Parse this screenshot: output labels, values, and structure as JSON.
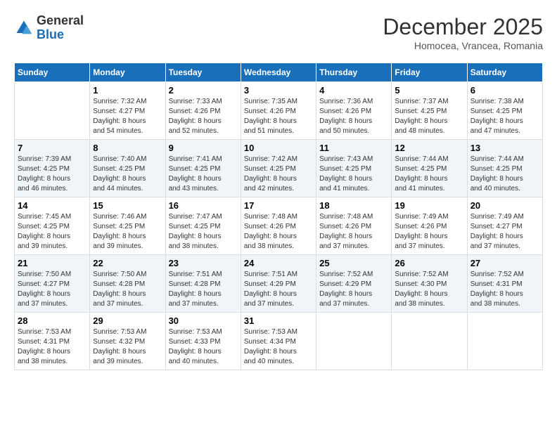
{
  "header": {
    "logo_line1": "General",
    "logo_line2": "Blue",
    "month_title": "December 2025",
    "subtitle": "Homocea, Vrancea, Romania"
  },
  "weekdays": [
    "Sunday",
    "Monday",
    "Tuesday",
    "Wednesday",
    "Thursday",
    "Friday",
    "Saturday"
  ],
  "weeks": [
    [
      {
        "day": "",
        "info": ""
      },
      {
        "day": "1",
        "info": "Sunrise: 7:32 AM\nSunset: 4:27 PM\nDaylight: 8 hours\nand 54 minutes."
      },
      {
        "day": "2",
        "info": "Sunrise: 7:33 AM\nSunset: 4:26 PM\nDaylight: 8 hours\nand 52 minutes."
      },
      {
        "day": "3",
        "info": "Sunrise: 7:35 AM\nSunset: 4:26 PM\nDaylight: 8 hours\nand 51 minutes."
      },
      {
        "day": "4",
        "info": "Sunrise: 7:36 AM\nSunset: 4:26 PM\nDaylight: 8 hours\nand 50 minutes."
      },
      {
        "day": "5",
        "info": "Sunrise: 7:37 AM\nSunset: 4:25 PM\nDaylight: 8 hours\nand 48 minutes."
      },
      {
        "day": "6",
        "info": "Sunrise: 7:38 AM\nSunset: 4:25 PM\nDaylight: 8 hours\nand 47 minutes."
      }
    ],
    [
      {
        "day": "7",
        "info": "Sunrise: 7:39 AM\nSunset: 4:25 PM\nDaylight: 8 hours\nand 46 minutes."
      },
      {
        "day": "8",
        "info": "Sunrise: 7:40 AM\nSunset: 4:25 PM\nDaylight: 8 hours\nand 44 minutes."
      },
      {
        "day": "9",
        "info": "Sunrise: 7:41 AM\nSunset: 4:25 PM\nDaylight: 8 hours\nand 43 minutes."
      },
      {
        "day": "10",
        "info": "Sunrise: 7:42 AM\nSunset: 4:25 PM\nDaylight: 8 hours\nand 42 minutes."
      },
      {
        "day": "11",
        "info": "Sunrise: 7:43 AM\nSunset: 4:25 PM\nDaylight: 8 hours\nand 41 minutes."
      },
      {
        "day": "12",
        "info": "Sunrise: 7:44 AM\nSunset: 4:25 PM\nDaylight: 8 hours\nand 41 minutes."
      },
      {
        "day": "13",
        "info": "Sunrise: 7:44 AM\nSunset: 4:25 PM\nDaylight: 8 hours\nand 40 minutes."
      }
    ],
    [
      {
        "day": "14",
        "info": "Sunrise: 7:45 AM\nSunset: 4:25 PM\nDaylight: 8 hours\nand 39 minutes."
      },
      {
        "day": "15",
        "info": "Sunrise: 7:46 AM\nSunset: 4:25 PM\nDaylight: 8 hours\nand 39 minutes."
      },
      {
        "day": "16",
        "info": "Sunrise: 7:47 AM\nSunset: 4:25 PM\nDaylight: 8 hours\nand 38 minutes."
      },
      {
        "day": "17",
        "info": "Sunrise: 7:48 AM\nSunset: 4:26 PM\nDaylight: 8 hours\nand 38 minutes."
      },
      {
        "day": "18",
        "info": "Sunrise: 7:48 AM\nSunset: 4:26 PM\nDaylight: 8 hours\nand 37 minutes."
      },
      {
        "day": "19",
        "info": "Sunrise: 7:49 AM\nSunset: 4:26 PM\nDaylight: 8 hours\nand 37 minutes."
      },
      {
        "day": "20",
        "info": "Sunrise: 7:49 AM\nSunset: 4:27 PM\nDaylight: 8 hours\nand 37 minutes."
      }
    ],
    [
      {
        "day": "21",
        "info": "Sunrise: 7:50 AM\nSunset: 4:27 PM\nDaylight: 8 hours\nand 37 minutes."
      },
      {
        "day": "22",
        "info": "Sunrise: 7:50 AM\nSunset: 4:28 PM\nDaylight: 8 hours\nand 37 minutes."
      },
      {
        "day": "23",
        "info": "Sunrise: 7:51 AM\nSunset: 4:28 PM\nDaylight: 8 hours\nand 37 minutes."
      },
      {
        "day": "24",
        "info": "Sunrise: 7:51 AM\nSunset: 4:29 PM\nDaylight: 8 hours\nand 37 minutes."
      },
      {
        "day": "25",
        "info": "Sunrise: 7:52 AM\nSunset: 4:29 PM\nDaylight: 8 hours\nand 37 minutes."
      },
      {
        "day": "26",
        "info": "Sunrise: 7:52 AM\nSunset: 4:30 PM\nDaylight: 8 hours\nand 38 minutes."
      },
      {
        "day": "27",
        "info": "Sunrise: 7:52 AM\nSunset: 4:31 PM\nDaylight: 8 hours\nand 38 minutes."
      }
    ],
    [
      {
        "day": "28",
        "info": "Sunrise: 7:53 AM\nSunset: 4:31 PM\nDaylight: 8 hours\nand 38 minutes."
      },
      {
        "day": "29",
        "info": "Sunrise: 7:53 AM\nSunset: 4:32 PM\nDaylight: 8 hours\nand 39 minutes."
      },
      {
        "day": "30",
        "info": "Sunrise: 7:53 AM\nSunset: 4:33 PM\nDaylight: 8 hours\nand 40 minutes."
      },
      {
        "day": "31",
        "info": "Sunrise: 7:53 AM\nSunset: 4:34 PM\nDaylight: 8 hours\nand 40 minutes."
      },
      {
        "day": "",
        "info": ""
      },
      {
        "day": "",
        "info": ""
      },
      {
        "day": "",
        "info": ""
      }
    ]
  ]
}
